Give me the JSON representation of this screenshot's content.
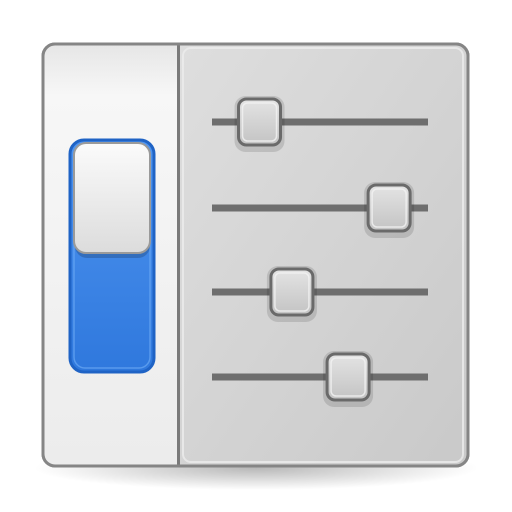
{
  "icon": {
    "name": "preferences-system-settings",
    "colors": {
      "toggle_accent": "#3d85e8",
      "toggle_accent_dark": "#2a6fd0",
      "toggle_border": "#1f63c5",
      "panel_light": "#f3f3f3",
      "panel_mid": "#d4d4d4",
      "frame_border": "#7a7a7a",
      "track": "#6e6e6e",
      "handle_fill": "#cfcfcf",
      "handle_border": "#6a6a6a"
    },
    "toggle": {
      "state": "off",
      "icon": "toggle-switch-icon"
    },
    "sliders": [
      {
        "icon": "slider-icon",
        "level": 0.22
      },
      {
        "icon": "slider-icon",
        "level": 0.82
      },
      {
        "icon": "slider-icon",
        "level": 0.37
      },
      {
        "icon": "slider-icon",
        "level": 0.63
      }
    ]
  }
}
